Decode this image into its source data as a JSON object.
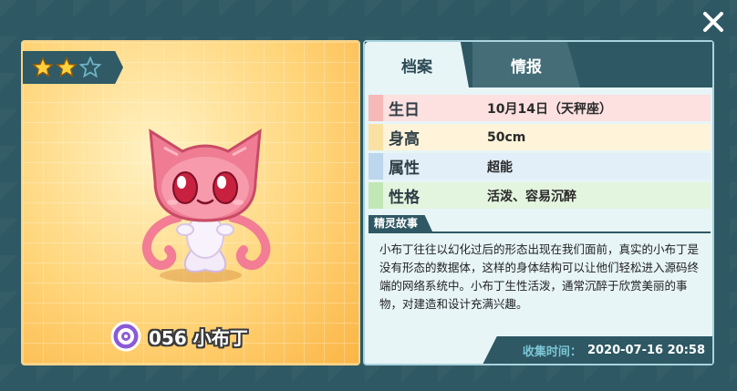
{
  "colors": {
    "background": "#2e5863",
    "card_yellow": "#ffd57a",
    "panel_bg": "#e7f5f7",
    "row_birthday": "#fde0e0",
    "row_height": "#fff4d9",
    "row_attribute": "#e2eef8",
    "row_personality": "#e4f5df"
  },
  "close": {
    "icon": "close-icon"
  },
  "pet": {
    "stars_filled": 2,
    "stars_total": 3,
    "number": "056",
    "name": "小布丁",
    "name_display": "056 小布丁",
    "attribute_icon": "psychic-attribute-icon"
  },
  "tabs": [
    {
      "label": "档案",
      "active": true
    },
    {
      "label": "情报",
      "active": false
    }
  ],
  "attributes": [
    {
      "label": "生日",
      "value": "10月14日（天秤座）"
    },
    {
      "label": "身高",
      "value": "50cm"
    },
    {
      "label": "属性",
      "value": "超能"
    },
    {
      "label": "性格",
      "value": "活泼、容易沉醉"
    }
  ],
  "story": {
    "title": "精灵故事",
    "text": "小布丁往往以幻化过后的形态出现在我们面前，真实的小布丁是没有形态的数据体，这样的身体结构可以让他们轻松进入源码终端的网络系统中。小布丁生性活泼，通常沉醉于欣赏美丽的事物，对建造和设计充满兴趣。"
  },
  "collect": {
    "label": "收集时间：",
    "time": "2020-07-16 20:58"
  }
}
